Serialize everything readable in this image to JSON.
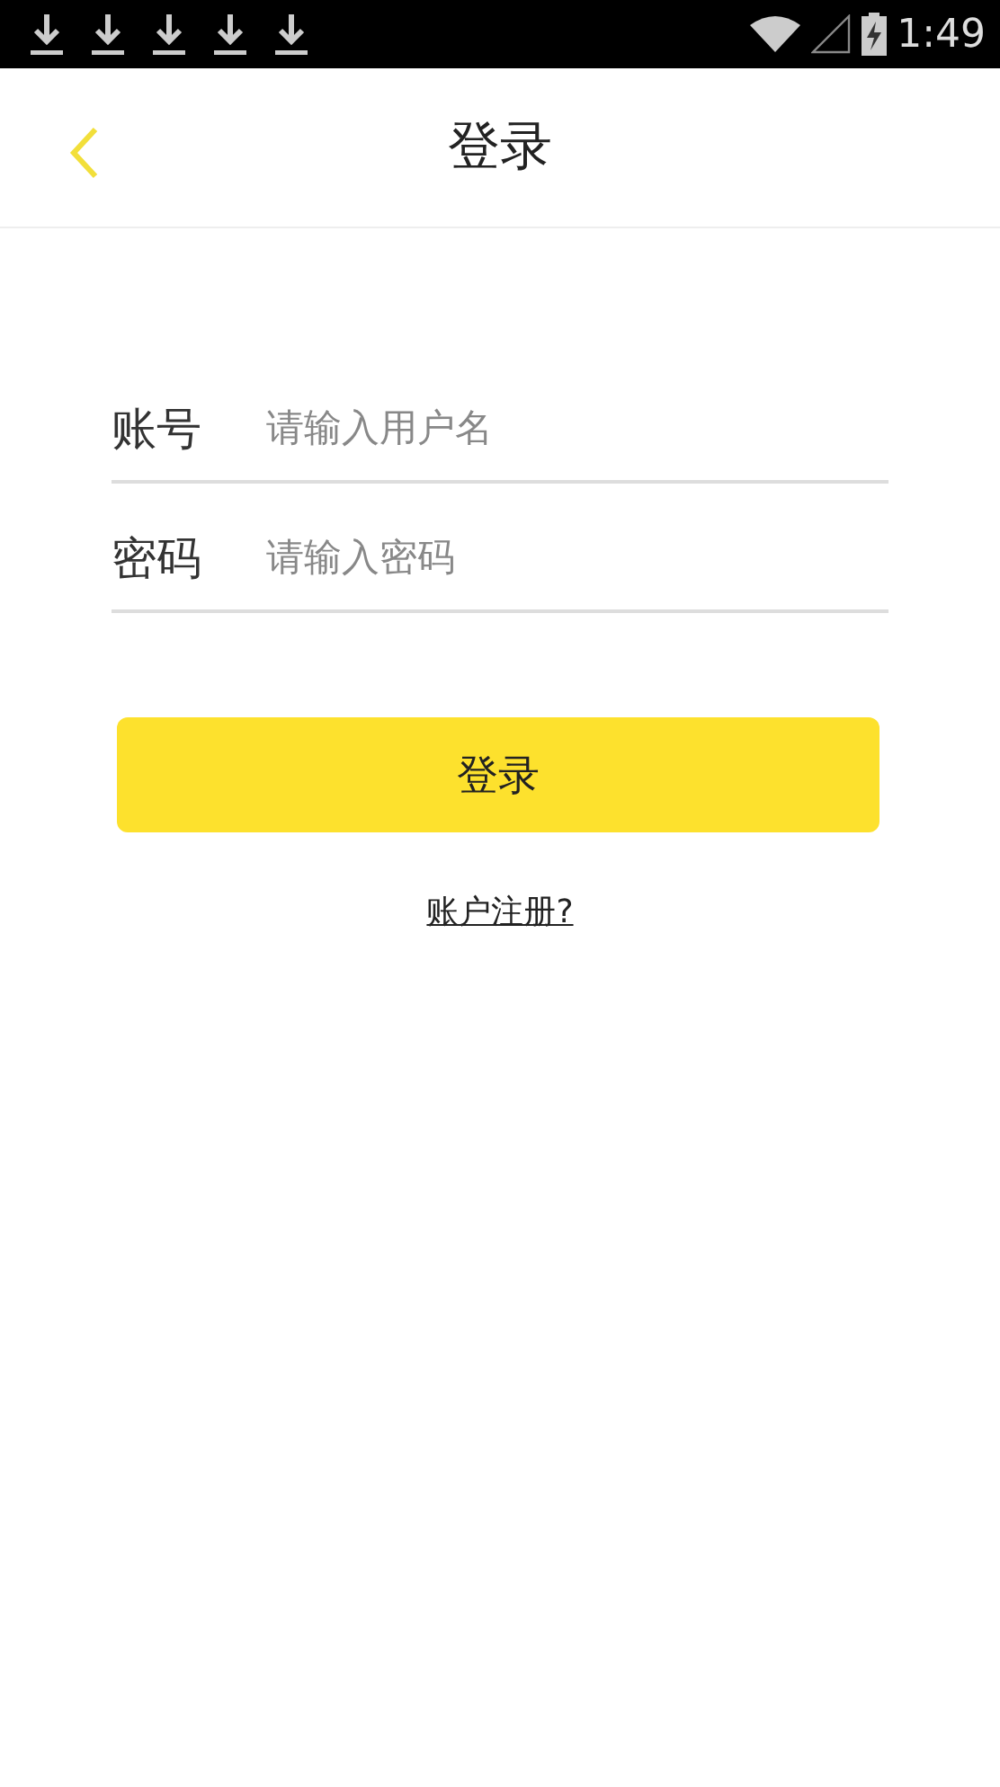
{
  "status_bar": {
    "notifications": [
      {
        "kind": "download"
      },
      {
        "kind": "download"
      },
      {
        "kind": "download"
      },
      {
        "kind": "download"
      },
      {
        "kind": "download"
      }
    ],
    "time": "1:49"
  },
  "header": {
    "title": "登录"
  },
  "fields": [
    {
      "label": "账号",
      "placeholder": "请输入用户名"
    },
    {
      "label": "密码",
      "placeholder": "请输入密码"
    }
  ],
  "login_button": "登录",
  "register_link": "账户注册?"
}
